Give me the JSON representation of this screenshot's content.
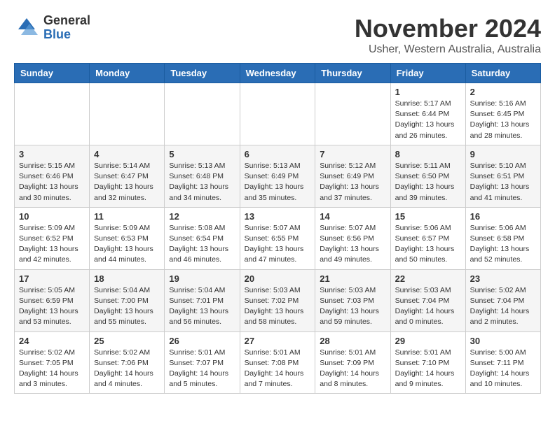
{
  "header": {
    "logo_general": "General",
    "logo_blue": "Blue",
    "month_title": "November 2024",
    "location": "Usher, Western Australia, Australia"
  },
  "calendar": {
    "days_of_week": [
      "Sunday",
      "Monday",
      "Tuesday",
      "Wednesday",
      "Thursday",
      "Friday",
      "Saturday"
    ],
    "weeks": [
      [
        {
          "day": "",
          "info": ""
        },
        {
          "day": "",
          "info": ""
        },
        {
          "day": "",
          "info": ""
        },
        {
          "day": "",
          "info": ""
        },
        {
          "day": "",
          "info": ""
        },
        {
          "day": "1",
          "info": "Sunrise: 5:17 AM\nSunset: 6:44 PM\nDaylight: 13 hours and 26 minutes."
        },
        {
          "day": "2",
          "info": "Sunrise: 5:16 AM\nSunset: 6:45 PM\nDaylight: 13 hours and 28 minutes."
        }
      ],
      [
        {
          "day": "3",
          "info": "Sunrise: 5:15 AM\nSunset: 6:46 PM\nDaylight: 13 hours and 30 minutes."
        },
        {
          "day": "4",
          "info": "Sunrise: 5:14 AM\nSunset: 6:47 PM\nDaylight: 13 hours and 32 minutes."
        },
        {
          "day": "5",
          "info": "Sunrise: 5:13 AM\nSunset: 6:48 PM\nDaylight: 13 hours and 34 minutes."
        },
        {
          "day": "6",
          "info": "Sunrise: 5:13 AM\nSunset: 6:49 PM\nDaylight: 13 hours and 35 minutes."
        },
        {
          "day": "7",
          "info": "Sunrise: 5:12 AM\nSunset: 6:49 PM\nDaylight: 13 hours and 37 minutes."
        },
        {
          "day": "8",
          "info": "Sunrise: 5:11 AM\nSunset: 6:50 PM\nDaylight: 13 hours and 39 minutes."
        },
        {
          "day": "9",
          "info": "Sunrise: 5:10 AM\nSunset: 6:51 PM\nDaylight: 13 hours and 41 minutes."
        }
      ],
      [
        {
          "day": "10",
          "info": "Sunrise: 5:09 AM\nSunset: 6:52 PM\nDaylight: 13 hours and 42 minutes."
        },
        {
          "day": "11",
          "info": "Sunrise: 5:09 AM\nSunset: 6:53 PM\nDaylight: 13 hours and 44 minutes."
        },
        {
          "day": "12",
          "info": "Sunrise: 5:08 AM\nSunset: 6:54 PM\nDaylight: 13 hours and 46 minutes."
        },
        {
          "day": "13",
          "info": "Sunrise: 5:07 AM\nSunset: 6:55 PM\nDaylight: 13 hours and 47 minutes."
        },
        {
          "day": "14",
          "info": "Sunrise: 5:07 AM\nSunset: 6:56 PM\nDaylight: 13 hours and 49 minutes."
        },
        {
          "day": "15",
          "info": "Sunrise: 5:06 AM\nSunset: 6:57 PM\nDaylight: 13 hours and 50 minutes."
        },
        {
          "day": "16",
          "info": "Sunrise: 5:06 AM\nSunset: 6:58 PM\nDaylight: 13 hours and 52 minutes."
        }
      ],
      [
        {
          "day": "17",
          "info": "Sunrise: 5:05 AM\nSunset: 6:59 PM\nDaylight: 13 hours and 53 minutes."
        },
        {
          "day": "18",
          "info": "Sunrise: 5:04 AM\nSunset: 7:00 PM\nDaylight: 13 hours and 55 minutes."
        },
        {
          "day": "19",
          "info": "Sunrise: 5:04 AM\nSunset: 7:01 PM\nDaylight: 13 hours and 56 minutes."
        },
        {
          "day": "20",
          "info": "Sunrise: 5:03 AM\nSunset: 7:02 PM\nDaylight: 13 hours and 58 minutes."
        },
        {
          "day": "21",
          "info": "Sunrise: 5:03 AM\nSunset: 7:03 PM\nDaylight: 13 hours and 59 minutes."
        },
        {
          "day": "22",
          "info": "Sunrise: 5:03 AM\nSunset: 7:04 PM\nDaylight: 14 hours and 0 minutes."
        },
        {
          "day": "23",
          "info": "Sunrise: 5:02 AM\nSunset: 7:04 PM\nDaylight: 14 hours and 2 minutes."
        }
      ],
      [
        {
          "day": "24",
          "info": "Sunrise: 5:02 AM\nSunset: 7:05 PM\nDaylight: 14 hours and 3 minutes."
        },
        {
          "day": "25",
          "info": "Sunrise: 5:02 AM\nSunset: 7:06 PM\nDaylight: 14 hours and 4 minutes."
        },
        {
          "day": "26",
          "info": "Sunrise: 5:01 AM\nSunset: 7:07 PM\nDaylight: 14 hours and 5 minutes."
        },
        {
          "day": "27",
          "info": "Sunrise: 5:01 AM\nSunset: 7:08 PM\nDaylight: 14 hours and 7 minutes."
        },
        {
          "day": "28",
          "info": "Sunrise: 5:01 AM\nSunset: 7:09 PM\nDaylight: 14 hours and 8 minutes."
        },
        {
          "day": "29",
          "info": "Sunrise: 5:01 AM\nSunset: 7:10 PM\nDaylight: 14 hours and 9 minutes."
        },
        {
          "day": "30",
          "info": "Sunrise: 5:00 AM\nSunset: 7:11 PM\nDaylight: 14 hours and 10 minutes."
        }
      ]
    ]
  }
}
